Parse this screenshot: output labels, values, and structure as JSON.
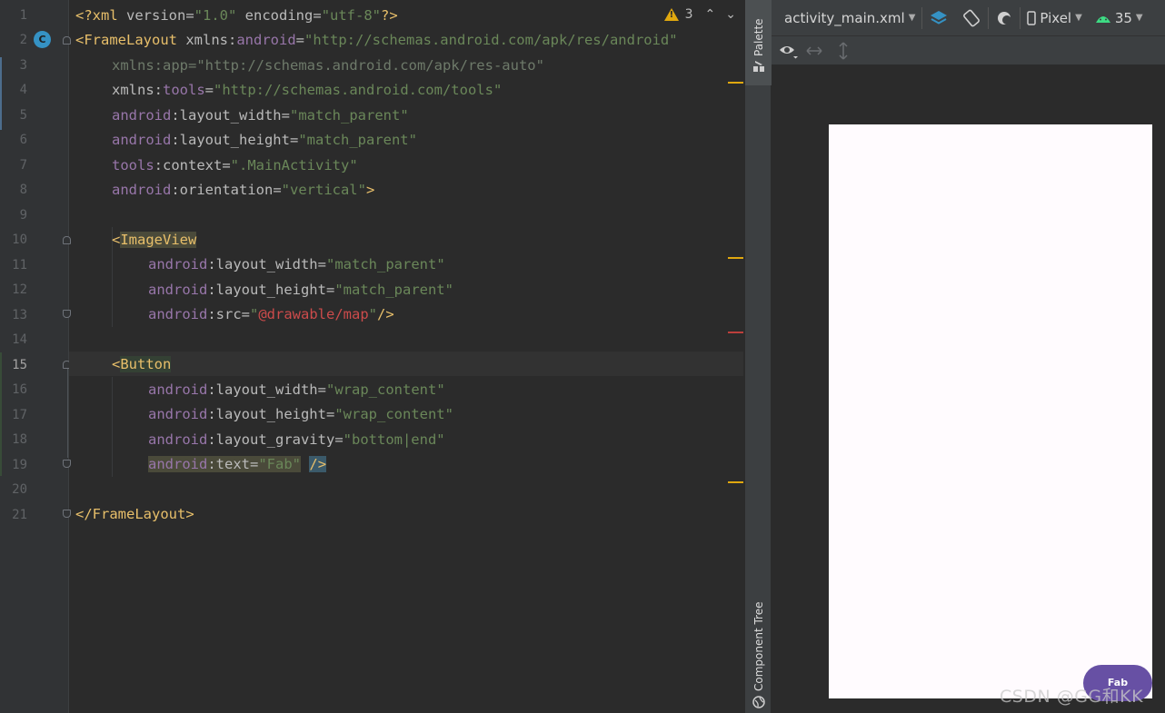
{
  "editor": {
    "lines": [
      {
        "num": "1"
      },
      {
        "num": "2"
      },
      {
        "num": "3"
      },
      {
        "num": "4"
      },
      {
        "num": "5"
      },
      {
        "num": "6"
      },
      {
        "num": "7"
      },
      {
        "num": "8"
      },
      {
        "num": "9"
      },
      {
        "num": "10"
      },
      {
        "num": "11"
      },
      {
        "num": "12"
      },
      {
        "num": "13"
      },
      {
        "num": "14"
      },
      {
        "num": "15"
      },
      {
        "num": "16"
      },
      {
        "num": "17"
      },
      {
        "num": "18"
      },
      {
        "num": "19"
      },
      {
        "num": "20"
      },
      {
        "num": "21"
      }
    ],
    "current_line": "15",
    "gutter_class_icon": "C",
    "inspection": {
      "warning_count": "3"
    },
    "code": {
      "l1": {
        "open": "<?xml ",
        "p1": "version",
        "eq1": "=",
        "v1": "\"1.0\"",
        "p2": " encoding",
        "eq2": "=",
        "v2": "\"utf-8\"",
        "close": "?>"
      },
      "l2": {
        "tag": "<FrameLayout ",
        "ns": "xmlns:",
        "name": "android",
        "eq": "=",
        "val": "\"http://schemas.android.com/apk/res/android\""
      },
      "l3": {
        "ns": "xmlns:",
        "name": "app",
        "eq": "=",
        "val": "\"http://schemas.android.com/apk/res-auto\""
      },
      "l4": {
        "ns": "xmlns:",
        "name": "tools",
        "eq": "=",
        "val": "\"http://schemas.android.com/tools\""
      },
      "l5": {
        "ns": "android",
        "attr": ":layout_width",
        "eq": "=",
        "val": "\"match_parent\""
      },
      "l6": {
        "ns": "android",
        "attr": ":layout_height",
        "eq": "=",
        "val": "\"match_parent\""
      },
      "l7": {
        "ns": "tools",
        "attr": ":context",
        "eq": "=",
        "val": "\".MainActivity\""
      },
      "l8": {
        "ns": "android",
        "attr": ":orientation",
        "eq": "=",
        "val": "\"vertical\"",
        "close": ">"
      },
      "l10": {
        "lt": "<",
        "tag": "ImageView"
      },
      "l11": {
        "ns": "android",
        "attr": ":layout_width",
        "eq": "=",
        "val": "\"match_parent\""
      },
      "l12": {
        "ns": "android",
        "attr": ":layout_height",
        "eq": "=",
        "val": "\"match_parent\""
      },
      "l13": {
        "ns": "android",
        "attr": ":src",
        "eq": "=",
        "q1": "\"",
        "val": "@drawable/map",
        "q2": "\"",
        "close": "/>"
      },
      "l15": {
        "lt": "<",
        "tag": "Button"
      },
      "l16": {
        "ns": "android",
        "attr": ":layout_width",
        "eq": "=",
        "val": "\"wrap_content\""
      },
      "l17": {
        "ns": "android",
        "attr": ":layout_height",
        "eq": "=",
        "val": "\"wrap_content\""
      },
      "l18": {
        "ns": "android",
        "attr": ":layout_gravity",
        "eq": "=",
        "val": "\"bottom|end\""
      },
      "l19": {
        "ns": "android",
        "attr": ":text",
        "eq": "=",
        "val": "\"Fab\"",
        "close": "/>"
      },
      "l21": {
        "tag": "</FrameLayout>"
      }
    }
  },
  "sidebar": {
    "palette_label": "Palette",
    "component_tree_label": "Component Tree"
  },
  "design": {
    "file_dropdown": "activity_main.xml",
    "device_dropdown": "Pixel",
    "api_dropdown": "35",
    "preview_button_label": "Fab"
  },
  "watermark": "CSDN @GG和KK",
  "colors": {
    "accent_fab": "#6750a4",
    "warning": "#e0a80f",
    "class_icon": "#3592c4",
    "android_green": "#3ddc84"
  }
}
